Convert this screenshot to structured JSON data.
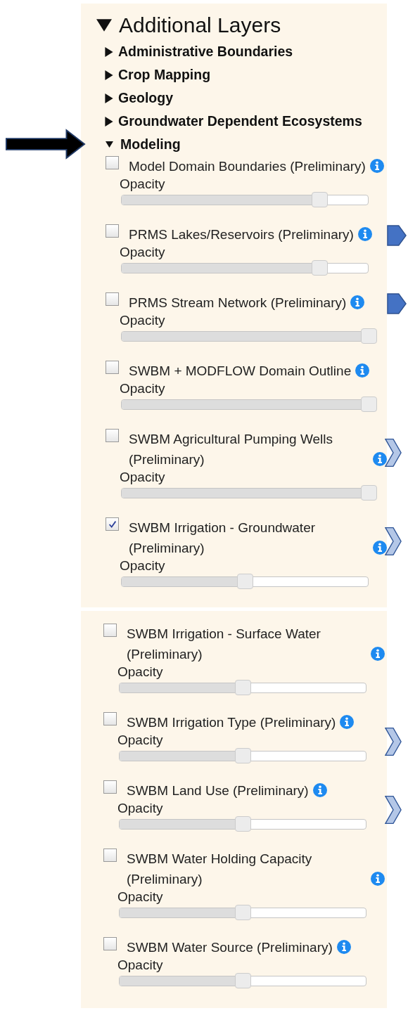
{
  "title": {
    "label": "Additional Layers",
    "expanded": true
  },
  "groups": [
    {
      "label": "Administrative Boundaries",
      "expanded": false,
      "pointed_at": false
    },
    {
      "label": "Crop Mapping",
      "expanded": false,
      "pointed_at": false
    },
    {
      "label": "Geology",
      "expanded": false,
      "pointed_at": false
    },
    {
      "label": "Groundwater Dependent Ecosystems",
      "expanded": false,
      "pointed_at": false
    },
    {
      "label": "Modeling",
      "expanded": true,
      "pointed_at": true,
      "layers": [
        {
          "name": "Model Domain Boundaries (Preliminary)",
          "checked": false,
          "slider_label": "Opacity",
          "level": 0.8
        },
        {
          "name": "PRMS Lakes/Reservoirs (Preliminary)",
          "checked": false,
          "slider_label": "Opacity",
          "level": 0.8,
          "marker": {
            "kind": "pentagon"
          }
        },
        {
          "name": "PRMS Stream Network (Preliminary)",
          "checked": false,
          "slider_label": "Opacity",
          "level": 1,
          "marker": {
            "kind": "pentagon"
          }
        },
        {
          "name": "SWBM + MODFLOW Domain Outline",
          "checked": false,
          "slider_label": "Opacity",
          "level": 1
        },
        {
          "name": "SWBM Agricultural Pumping Wells (Preliminary)",
          "checked": false,
          "slider_label": "Opacity",
          "level": 1,
          "marker": {
            "kind": "chevron"
          }
        },
        {
          "name": "SWBM Irrigation - Groundwater (Preliminary)",
          "checked": true,
          "slider_label": "Opacity",
          "level": 0.5,
          "marker": {
            "kind": "chevron"
          }
        }
      ]
    }
  ],
  "continued_layers": [
    {
      "name": "SWBM Irrigation - Surface Water (Preliminary)",
      "checked": false,
      "slider_label": "Opacity",
      "level": 0.5
    },
    {
      "name": "SWBM Irrigation Type (Preliminary)",
      "checked": false,
      "slider_label": "Opacity",
      "level": 0.5,
      "marker": {
        "kind": "chevron"
      }
    },
    {
      "name": "SWBM Land Use (Preliminary)",
      "checked": false,
      "slider_label": "Opacity",
      "level": 0.5,
      "marker": {
        "kind": "chevron"
      }
    },
    {
      "name": "SWBM Water Holding Capacity (Preliminary)",
      "checked": false,
      "slider_label": "Opacity",
      "level": 0.5
    },
    {
      "name": "SWBM Water Source (Preliminary)",
      "checked": false,
      "slider_label": "Opacity",
      "level": 0.5
    }
  ]
}
